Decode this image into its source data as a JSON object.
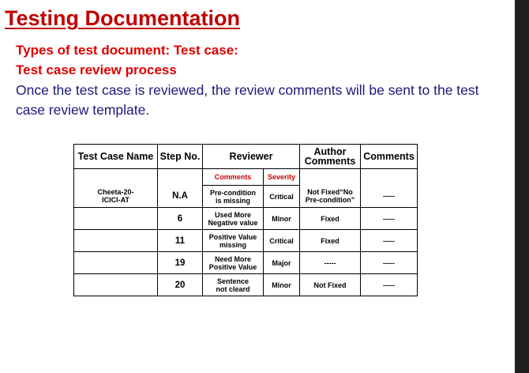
{
  "slide": {
    "title": "Testing Documentation",
    "subtitle1": "Types of test document: Test case:",
    "subtitle2": "Test case review process",
    "paragraph": "Once the test case is reviewed, the review comments will be sent to the test case review template."
  },
  "table": {
    "headers": {
      "test_case_name": "Test Case Name",
      "step_no": "Step No.",
      "reviewer": "Reviewer",
      "author_comments_line1": "Author",
      "author_comments_line2": "Comments",
      "comments": "Comments"
    },
    "subheaders": {
      "comments": "Comments",
      "severity": "Severity"
    },
    "test_case": {
      "name_line1": "Cheeta-20-",
      "name_line2": "ICICI-AT"
    },
    "rows": [
      {
        "step": "N.A",
        "comment_line1": "Pre-condition",
        "comment_line2": "is missing",
        "severity": "Critical",
        "author_line1": "Not Fixed“No",
        "author_line2": "Pre-condition”",
        "comments": "-----"
      },
      {
        "step": "6",
        "comment_line1": "Used More",
        "comment_line2": "Negative value",
        "severity": "Minor",
        "author_line1": "Fixed",
        "author_line2": "",
        "comments": "-----"
      },
      {
        "step": "11",
        "comment_line1": "Positive Value",
        "comment_line2": "missing",
        "severity": "Critical",
        "author_line1": "Fixed",
        "author_line2": "",
        "comments": "-----"
      },
      {
        "step": "19",
        "comment_line1": "Need More",
        "comment_line2": "Positive Value",
        "severity": "Major",
        "author_line1": "-----",
        "author_line2": "",
        "comments": "-----"
      },
      {
        "step": "20",
        "comment_line1": "Sentence",
        "comment_line2": "not cleard",
        "severity": "Minor",
        "author_line1": "Not Fixed",
        "author_line2": "",
        "comments": "-----"
      }
    ]
  },
  "colors": {
    "title": "#c00000",
    "subtitle": "#e00000",
    "body_text": "#1a1a7a",
    "subheader": "#cc0000"
  }
}
